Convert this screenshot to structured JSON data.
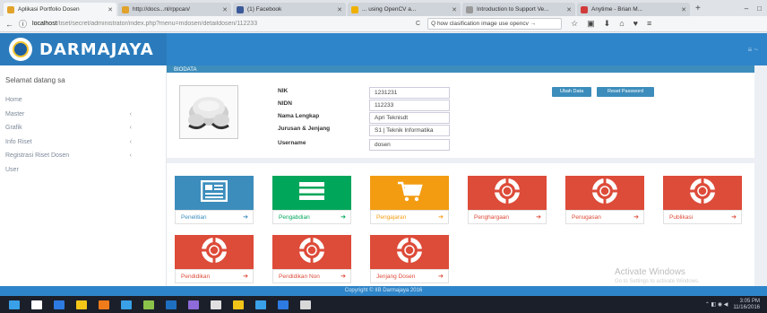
{
  "browser": {
    "tabs": [
      {
        "label": "Aplikasi Portfolio Dosen",
        "color": "#e1a32b",
        "active": true
      },
      {
        "label": "http://docs...nl/rppcan/",
        "color": "#e1a32b",
        "active": false
      },
      {
        "label": "(1) Facebook",
        "color": "#3b5998",
        "active": false
      },
      {
        "label": "... using OpenCV a...",
        "color": "#f0b000",
        "active": false
      },
      {
        "label": "Introduction to Support Ve...",
        "color": "#999999",
        "active": false
      },
      {
        "label": "Anytime - Brian M...",
        "color": "#d23b3b",
        "active": false
      }
    ],
    "new_tab": "+",
    "win_controls": [
      "–",
      "□"
    ],
    "nav_back": "←",
    "nav_info": "ⓘ",
    "url_host": "localhost",
    "url_path": "/tiset/secret/administrator/index.php?menu=mdosen/detaildosen/112233",
    "reload": "C",
    "search_text": "Q how clasification image use opencv →",
    "tool_icons": [
      "☆",
      "▣",
      "⬇",
      "⌂",
      "♥",
      "≡"
    ]
  },
  "header": {
    "brand": "DARMAJAYA",
    "toggle": "≡ ~"
  },
  "sidebar": {
    "welcome": "Selamat datang sa",
    "items": [
      {
        "label": "Home",
        "chevron": ""
      },
      {
        "label": "Master",
        "chevron": "‹"
      },
      {
        "label": "Grafik",
        "chevron": "‹"
      },
      {
        "label": "Info Riset",
        "chevron": "‹"
      },
      {
        "label": "Registrasi Riset Dosen",
        "chevron": "‹"
      },
      {
        "label": "User",
        "chevron": ""
      }
    ]
  },
  "profile": {
    "box_title": "BIODATA",
    "fields": [
      {
        "label": "NIK",
        "value": "1231231"
      },
      {
        "label": "NIDN",
        "value": "112233"
      },
      {
        "label": "Nama Lengkap",
        "value": "Apri Teknisdt"
      },
      {
        "label": "Jurusan & Jenjang",
        "value": "S1 | Teknik Informatika"
      },
      {
        "label": "Username",
        "value": "dosen"
      }
    ],
    "buttons": {
      "edit": "Ubah Data",
      "reset": "Reset Password"
    }
  },
  "tiles": [
    {
      "label": "Penelitian",
      "color": "#3c8dbc",
      "icon": "newspaper-icon",
      "text_color": "#3c8dbc"
    },
    {
      "label": "Pengabdian",
      "color": "#00a65a",
      "icon": "list-icon",
      "text_color": "#00a65a"
    },
    {
      "label": "Pengajaran",
      "color": "#f39c12",
      "icon": "cart-icon",
      "text_color": "#f39c12"
    },
    {
      "label": "Penghargaan",
      "color": "#dd4b39",
      "icon": "lifebuoy-icon",
      "text_color": "#dd4b39"
    },
    {
      "label": "Penugasan",
      "color": "#dd4b39",
      "icon": "lifebuoy-icon",
      "text_color": "#dd4b39"
    },
    {
      "label": "Publikasi",
      "color": "#dd4b39",
      "icon": "lifebuoy-icon",
      "text_color": "#dd4b39"
    },
    {
      "label": "Pendidikan",
      "color": "#dd4b39",
      "icon": "lifebuoy-icon",
      "text_color": "#dd4b39"
    },
    {
      "label": "Pendidikan Non",
      "color": "#dd4b39",
      "icon": "lifebuoy-icon",
      "text_color": "#dd4b39"
    },
    {
      "label": "Jenjang Dosen",
      "color": "#dd4b39",
      "icon": "lifebuoy-icon",
      "text_color": "#dd4b39"
    }
  ],
  "tile_arrow": "➔",
  "watermark": {
    "line1": "Activate Windows",
    "line2": "Go to Settings to activate Windows."
  },
  "footer": {
    "text": "Copyright © IIB Darmajaya 2016"
  },
  "taskbar": {
    "icons": [
      "#3aa0e8",
      "#ffffff",
      "#2d7be0",
      "#f5c518",
      "#f07b1a",
      "#3aa0e8",
      "#8bc34a",
      "#1f6fc1",
      "#8e6bd8",
      "#e0e0e0",
      "#f0c419",
      "#3aa0e8",
      "#2d7be0",
      "#d8d8d8"
    ],
    "tray_time": "3:05 PM",
    "tray_date": "11/16/2016"
  }
}
